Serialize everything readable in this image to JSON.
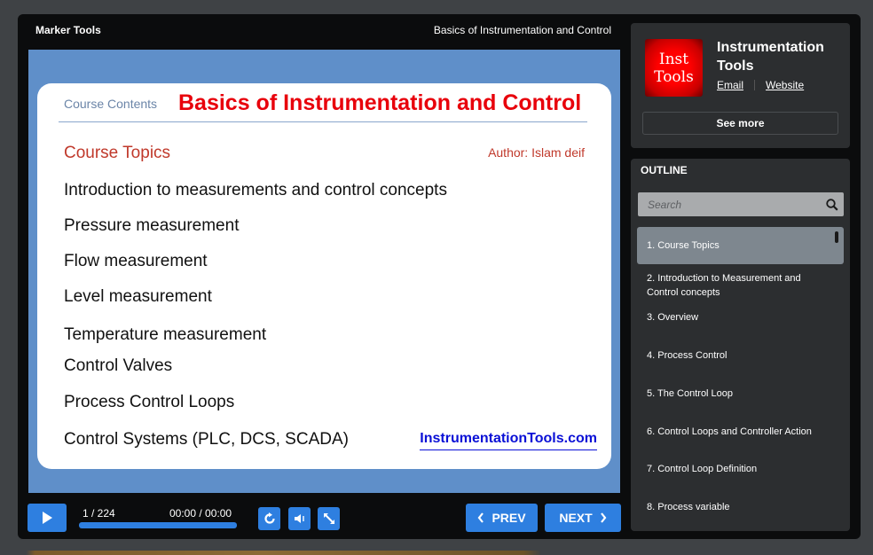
{
  "topbar": {
    "left_title": "Marker Tools",
    "course_title": "Basics of Instrumentation and Control"
  },
  "slide": {
    "header_label": "Course Contents",
    "title": "Basics of Instrumentation and Control",
    "topics_heading": "Course Topics",
    "author": "Author: Islam deif",
    "topics": [
      "Introduction to measurements and control concepts",
      "Pressure measurement",
      "Flow measurement",
      "Level measurement",
      "Temperature measurement",
      "Control Valves",
      "Process Control Loops",
      "Control Systems (PLC, DCS, SCADA)"
    ],
    "link": "InstrumentationTools.com"
  },
  "controls": {
    "play_icon": "play-icon",
    "slide_counter": "1 / 224",
    "time": "00:00 / 00:00",
    "progress": 1.0,
    "replay_icon": "replay-icon",
    "volume_icon": "volume-icon",
    "fullscreen_icon": "fullscreen-icon",
    "prev_label": "PREV",
    "next_label": "NEXT"
  },
  "author_card": {
    "logo_line1": "Inst",
    "logo_line2": "Tools",
    "name": "Instrumentation Tools",
    "email_label": "Email",
    "website_label": "Website",
    "see_more_label": "See more"
  },
  "outline": {
    "heading": "OUTLINE",
    "search_placeholder": "Search",
    "items": [
      {
        "label": "1. Course Topics",
        "active": true
      },
      {
        "label": "2. Introduction to Measurement and Control concepts",
        "active": false
      },
      {
        "label": "3. Overview",
        "active": false
      },
      {
        "label": "4. Process Control",
        "active": false
      },
      {
        "label": "5. The Control Loop",
        "active": false
      },
      {
        "label": "6. Control Loops and Controller Action",
        "active": false
      },
      {
        "label": "7. Control Loop Definition",
        "active": false
      },
      {
        "label": "8. Process variable",
        "active": false
      }
    ]
  },
  "colors": {
    "accent": "#2e7fe0",
    "slide_title": "#e8000b",
    "stage_bg": "#5f8fc9"
  }
}
